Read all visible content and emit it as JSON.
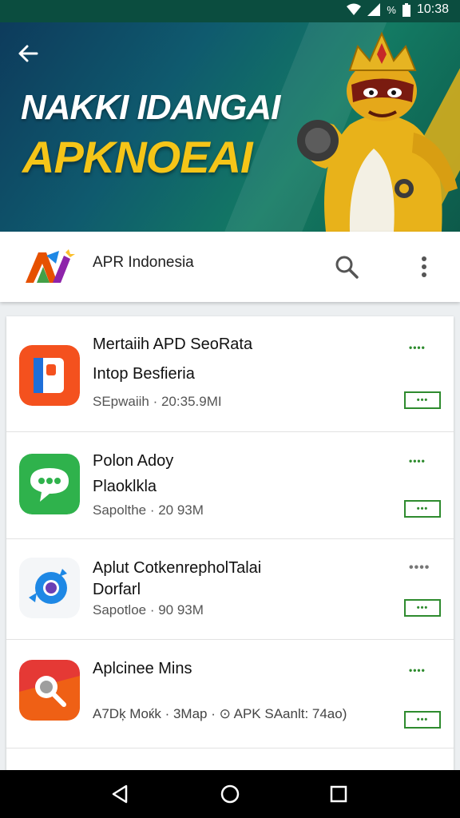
{
  "status": {
    "signal": "%",
    "time": "10:38"
  },
  "hero": {
    "line1": "NAKKI IDANGAI",
    "line2": "APKNOEAI"
  },
  "appbar": {
    "name": "APR Indonesia"
  },
  "apps": [
    {
      "title": "Mertaiih APD SeoRata",
      "subtitle": "Intop Besfieria",
      "meta": "SEpwaiih · 20:35.9MI",
      "rating": "••••",
      "badge": "•••",
      "icon_color": "#f4511e"
    },
    {
      "title": "Polon Adoy",
      "subtitle": "Plaoklkla",
      "meta": "Sapolthe · 20 93M",
      "rating": "••••",
      "badge": "•••",
      "icon_color": "#2fb24c"
    },
    {
      "title": "Aplut CotkenrepholTalai",
      "subtitle": "Dorfarl",
      "meta": "Sapotloe · 90 93M",
      "rating": "••••",
      "badge": "•••",
      "icon_color": "#1e88e5"
    },
    {
      "title": "Aplcinee Mins",
      "subtitle": "",
      "meta": "A7Dķ Moќk · 3Map · ⊙ APK SAanlt: 74ao)",
      "rating": "••••",
      "badge": "•••",
      "icon_color": "#e53935"
    }
  ]
}
